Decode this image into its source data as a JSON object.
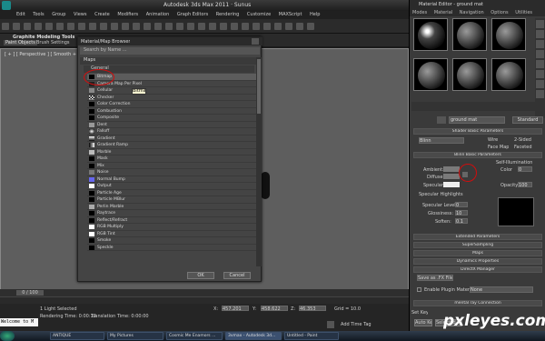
{
  "app": {
    "title": "Autodesk 3ds Max 2011 · Sunus",
    "menu": [
      "Edit",
      "Tools",
      "Group",
      "Views",
      "Create",
      "Modifiers",
      "Animation",
      "Graph Editors",
      "Rendering",
      "Customize",
      "MAXScript",
      "Help"
    ],
    "ribbon_tab": "Graphite Modeling Tools",
    "ribbon_subtabs": [
      "Paint Objects",
      "Brush Settings"
    ],
    "viewport_label": "[ + ] [ Perspective ] [ Smooth + Highlights ]"
  },
  "browser": {
    "title": "Material/Map Browser",
    "search_placeholder": "Search by Name ...",
    "section": "Maps",
    "subsection": "General",
    "items": [
      "Bitmap",
      "Camera Map Per Pixel",
      "Cellular",
      "Checker",
      "Color Correction",
      "Combustion",
      "Composite",
      "Dent",
      "Falloff",
      "Gradient",
      "Gradient Ramp",
      "Marble",
      "Mask",
      "Mix",
      "Noise",
      "Normal Bump",
      "Output",
      "Particle Age",
      "Particle MBlur",
      "Perlin Marble",
      "Raytrace",
      "Reflect/Refract",
      "RGB Multiply",
      "RGB Tint",
      "Smoke",
      "Speckle"
    ],
    "selected": "Bitmap",
    "tooltip": "Bitmap",
    "ok": "OK",
    "cancel": "Cancel"
  },
  "material_editor": {
    "title": "Material Editor - ground mat",
    "menu": [
      "Modes",
      "Material",
      "Navigation",
      "Options",
      "Utilities"
    ],
    "material_name": "ground mat",
    "material_type": "Standard",
    "shader_rollout": "Shader Basic Parameters",
    "shader": "Blinn",
    "shader_options": [
      "Wire",
      "2-Sided",
      "Face Map",
      "Faceted"
    ],
    "blinn_rollout": "Blinn Basic Parameters",
    "self_illum": "Self-Illumination",
    "color_label": "Color",
    "color_value": "0",
    "ambient": "Ambient:",
    "diffuse": "Diffuse:",
    "specular": "Specular:",
    "opacity_label": "Opacity:",
    "opacity_value": "100",
    "spec_highlights": "Specular Highlights",
    "spec_level": "Specular Level:",
    "spec_level_value": "0",
    "glossiness": "Glossiness:",
    "glossiness_value": "10",
    "soften": "Soften:",
    "soften_value": "0.1",
    "rollouts": [
      "Extended Parameters",
      "SuperSampling",
      "Maps",
      "Dynamics Properties",
      "DirectX Manager",
      "mental ray Connection"
    ],
    "save_fx": "Save as .FX File",
    "plugin_material": "Enable Plugin Material",
    "plugin_value": "None"
  },
  "status": {
    "selection": "1 Light Selected",
    "render_time": "Rendering Time: 0:00:12",
    "translation_time": "Translation Time: 0:00:00",
    "frame": "0 / 100",
    "x": "457.201",
    "y": "458.622",
    "z": "46.353",
    "grid": "Grid = 10.0",
    "add_time_tag": "Add Time Tag",
    "auto_key": "Auto Key",
    "selected": "Selected",
    "set_key": "Set Key",
    "key_filters": "Key Filters...",
    "frame_num": "0",
    "welcome": "Welcome to M"
  },
  "taskbar": [
    "ANTIQUE",
    "My Pictures",
    "Cosmic Me Enamors ...",
    "3vmax - Autodesk 3d...",
    "Untitled - Paint"
  ],
  "watermark": "pxleyes.com",
  "colors": {
    "highlight": "#d10d0d",
    "viewport": "#5e5e5e",
    "panel": "#3a3a3a"
  }
}
